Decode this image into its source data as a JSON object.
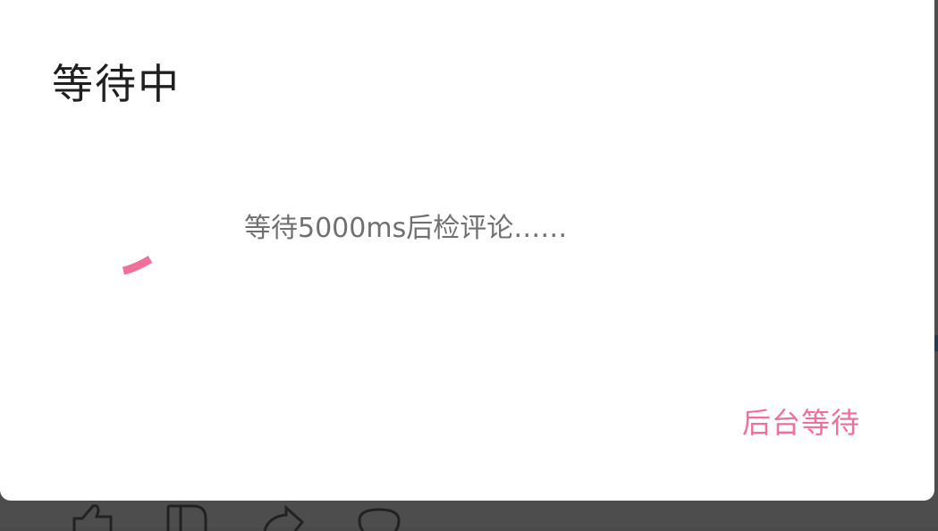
{
  "dialog": {
    "title": "等待中",
    "message": "等待5000ms后检评论……",
    "background_wait_button": "后台等待"
  },
  "colors": {
    "accent": "#f07099",
    "title": "#1f1f1f",
    "message": "#707070",
    "overlay": "#4d4d4d"
  },
  "action_bar": {
    "icons": [
      "thumb-up-icon",
      "bookmark-icon",
      "share-icon",
      "comment-icon"
    ]
  }
}
